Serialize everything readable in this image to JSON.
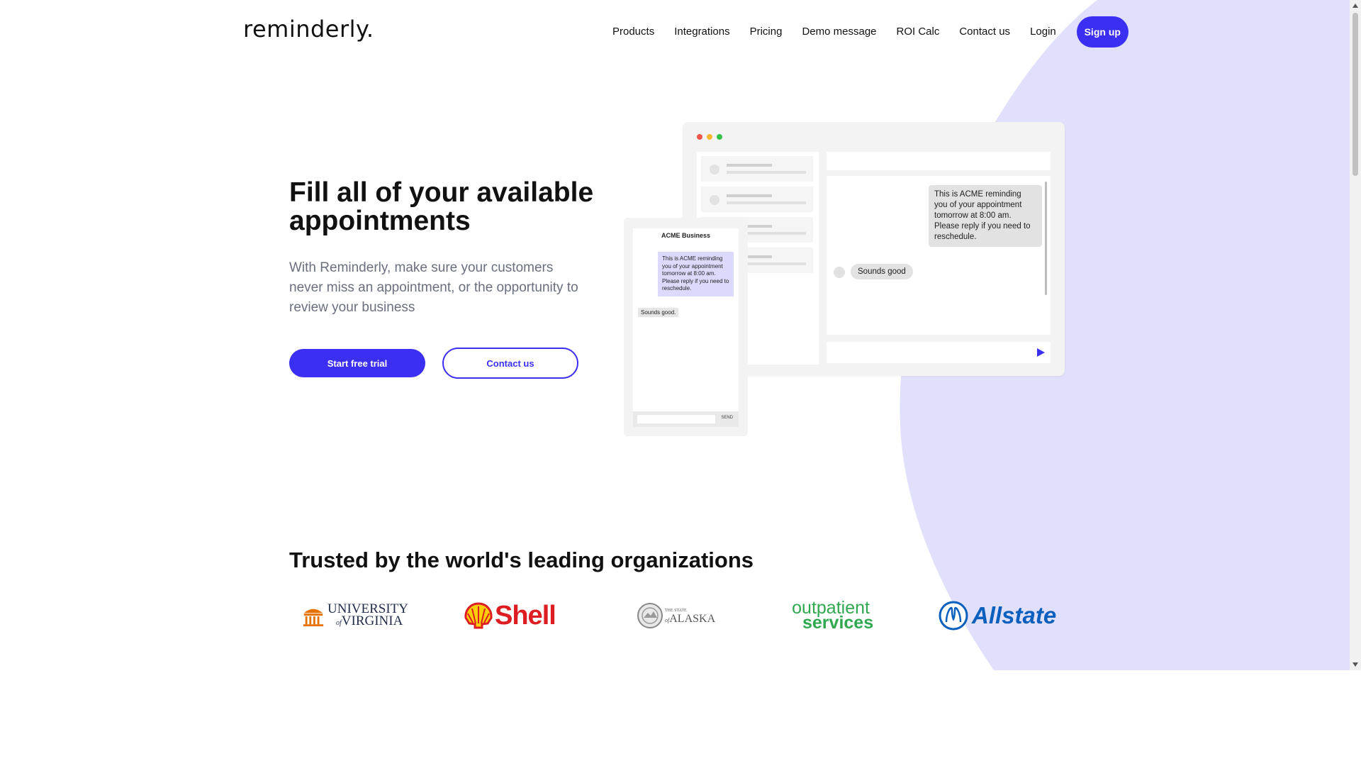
{
  "brand": {
    "logo": "reminderly.",
    "accent": "#3a2ff2",
    "blob_color": "#e1e0fc"
  },
  "nav": {
    "items": [
      "Products",
      "Integrations",
      "Pricing",
      "Demo message",
      "ROI Calc",
      "Contact us",
      "Login"
    ],
    "signup": "Sign up"
  },
  "hero": {
    "title": "Fill all of your available appointments",
    "subtitle": "With Reminderly, make sure your customers never miss an appointment, or the opportunity to review your business",
    "primary_cta": "Start free trial",
    "secondary_cta": "Contact us"
  },
  "desktop_mock": {
    "dots": [
      "#f0564a",
      "#f7b731",
      "#35c24a"
    ],
    "message": "This is ACME reminding you of your appointment tomorrow at 8:00 am. Please reply if you need to reschedule.",
    "reply": "Sounds good"
  },
  "phone_mock": {
    "title": "ACME Business",
    "message": "This is ACME reminding you of your appointment tomorrow at 8:00 am. Please reply if you need to reschedule.",
    "reply": "Sounds good.",
    "send": "SEND"
  },
  "trusted": {
    "heading": "Trusted by the world's leading organizations",
    "logos": [
      {
        "name": "university-of-virginia",
        "line1": "UNIVERSITY",
        "line2": "VIRGINIA",
        "of": "of",
        "color": "#232d4b",
        "accent": "#e57200"
      },
      {
        "name": "shell",
        "text": "Shell",
        "color": "#dd1d21",
        "accent": "#fbce07"
      },
      {
        "name": "state-of-alaska",
        "small": "THE STATE",
        "of": "of",
        "text": "ALASKA",
        "color": "#555555"
      },
      {
        "name": "outpatient-services",
        "line1": "outpatient",
        "line2": "services",
        "color": "#2fa84f"
      },
      {
        "name": "allstate",
        "text": "Allstate",
        "color": "#0a5fbf"
      }
    ]
  }
}
